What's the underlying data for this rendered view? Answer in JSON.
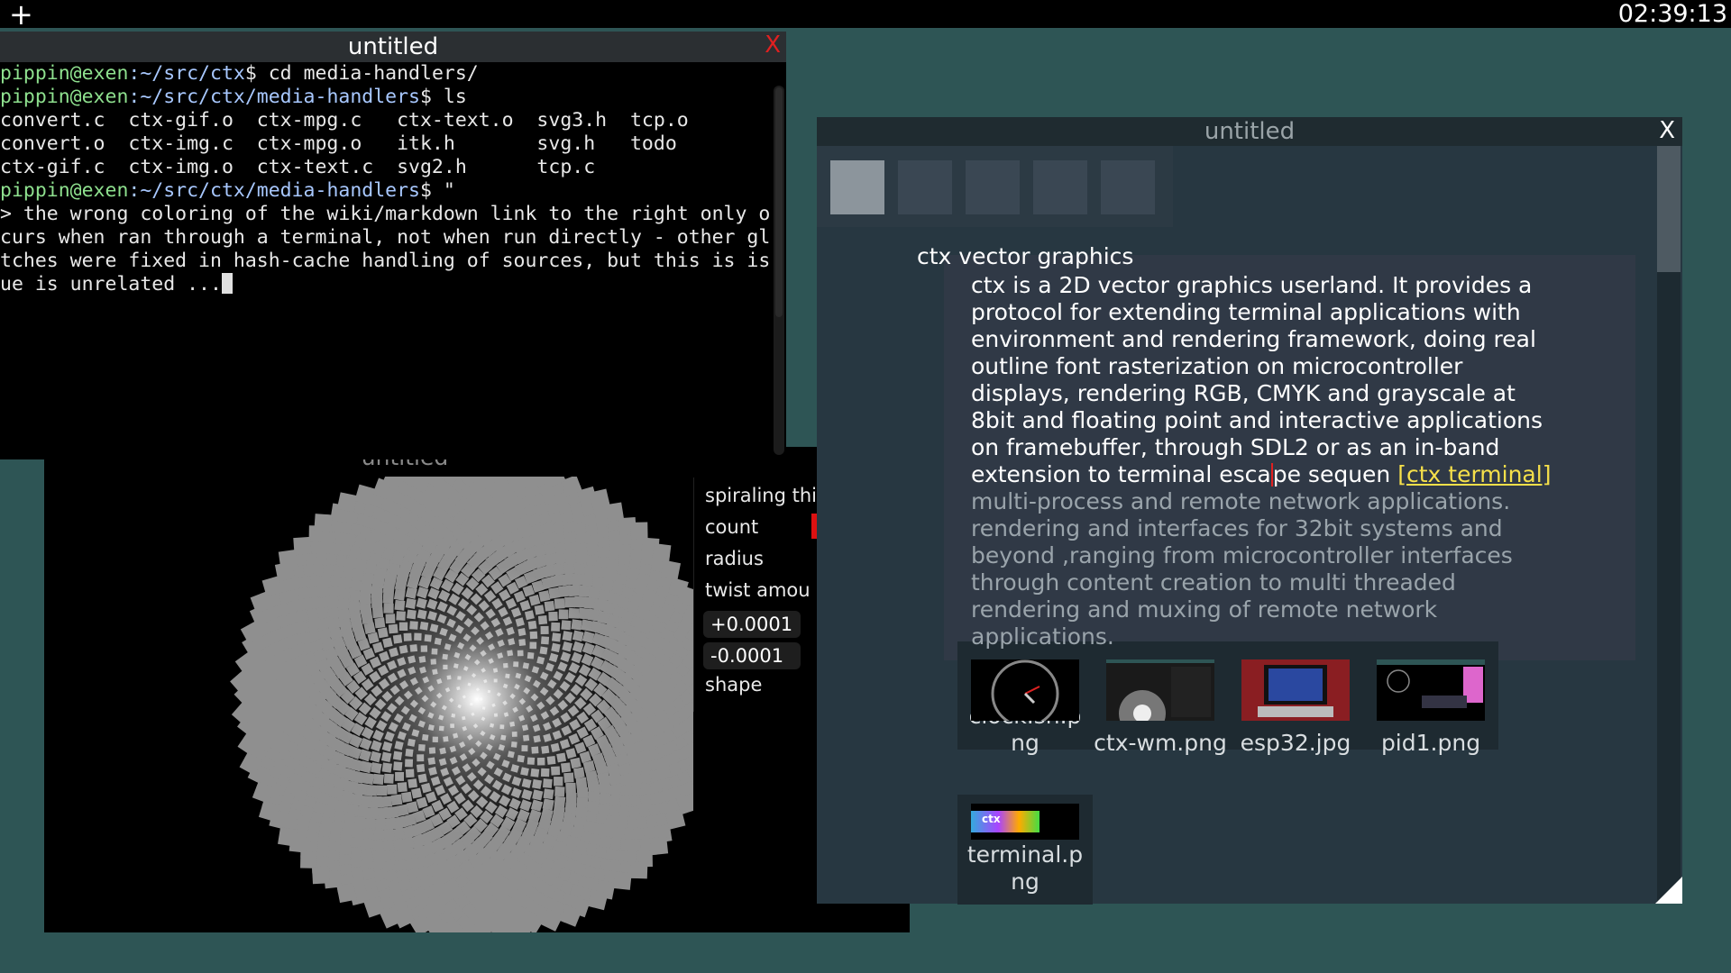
{
  "topbar": {
    "new_label": "+",
    "clock": "02:39:13"
  },
  "terminal": {
    "title": "untitled",
    "close": "X",
    "lines": [
      {
        "user": "pippin@exen",
        "path": ":~/src/ctx",
        "rest": "$ cd media-handlers/"
      },
      {
        "user": "pippin@exen",
        "path": ":~/src/ctx/media-handlers",
        "rest": "$ ls"
      },
      {
        "text": "convert.c  ctx-gif.o  ctx-mpg.c   ctx-text.o  svg3.h  tcp.o"
      },
      {
        "text": "convert.o  ctx-img.c  ctx-mpg.o   itk.h       svg.h   todo"
      },
      {
        "text": "ctx-gif.c  ctx-img.o  ctx-text.c  svg2.h      tcp.c"
      },
      {
        "user": "pippin@exen",
        "path": ":~/src/ctx/media-handlers",
        "rest": "$ \""
      },
      {
        "text": "> the wrong coloring of the wiki/markdown link to the right only oc"
      },
      {
        "text": "curs when ran through a terminal, not when run directly - other gli"
      },
      {
        "text": "tches were fixed in hash-cache handling of sources, but this is iss"
      },
      {
        "text": "ue is unrelated ..."
      }
    ]
  },
  "spiral": {
    "title": "untitled",
    "props": {
      "heading": "spiraling thi",
      "count": "count",
      "radius": "radius",
      "twist": "twist amou",
      "inc": "+0.0001",
      "dec": "-0.0001",
      "shape": "shape"
    },
    "colors": {
      "cell": "#8f8f8f",
      "bg": "#000000"
    }
  },
  "browser": {
    "title": "untitled",
    "close": "X",
    "doc_title": "ctx vector graphics",
    "para_lines": [
      "ctx is a 2D vector graphics userland. It provides a",
      "protocol for extending terminal applications with",
      "environment and rendering framework, doing real",
      "outline font rasterization on microcontroller",
      "displays, rendering RGB, CMYK and grayscale at",
      "8bit and floating point and interactive applications",
      "on framebuffer, through SDL2 or as an in-band"
    ],
    "line8_a": "extension to terminal esca",
    "line8_b": "pe sequen",
    "link": "[ctx terminal]",
    "dim_lines": [
      "multi-process and remote network applications.",
      "rendering and interfaces for 32bit systems and",
      "beyond ,ranging from microcontroller interfaces",
      "through content creation to multi threaded",
      "rendering and muxing of remote network",
      "applications."
    ],
    "gallery": [
      {
        "label1": "clock.sh.p",
        "label2": "ng",
        "icon": "clock-image"
      },
      {
        "label1": "ctx-wm.png",
        "label2": "",
        "icon": "ctx-wm-image"
      },
      {
        "label1": "esp32.jpg",
        "label2": "",
        "icon": "esp32-image"
      },
      {
        "label1": "pid1.png",
        "label2": "",
        "icon": "pid1-image"
      }
    ],
    "gallery2": {
      "label1": "terminal.p",
      "label2": "ng",
      "icon": "terminal-image"
    }
  }
}
